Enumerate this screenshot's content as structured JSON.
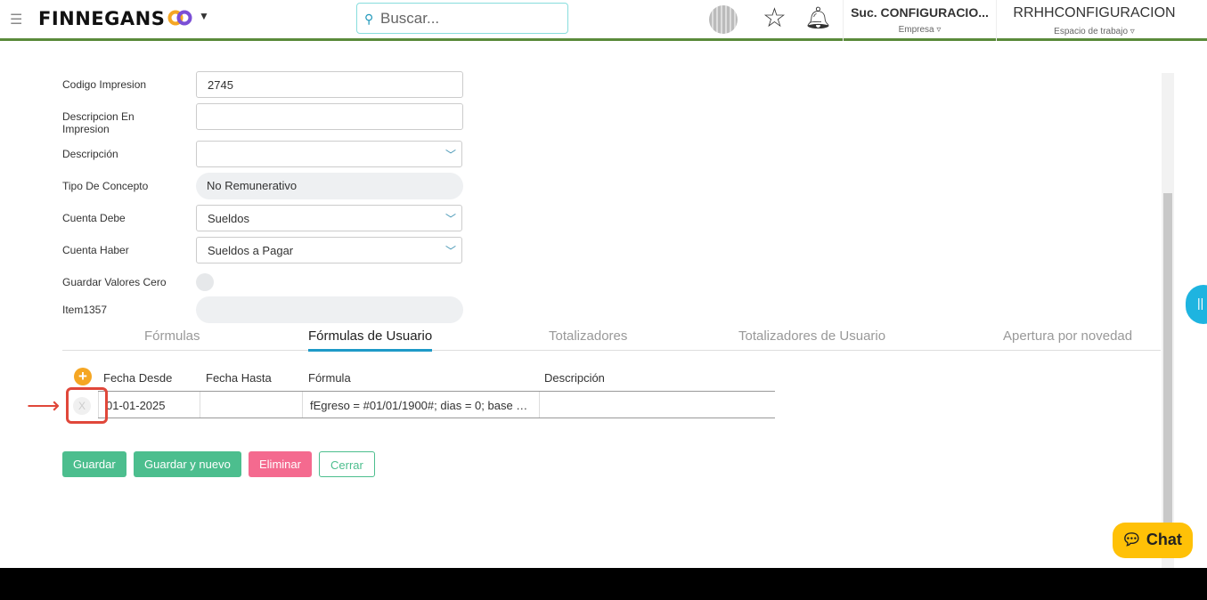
{
  "header": {
    "brand": "FINNEGANS",
    "search_placeholder": "Buscar...",
    "company": "Suc. CONFIGURACIO...",
    "company_label": "Empresa",
    "workspace": "RRHHCONFIGURACION",
    "workspace_label": "Espacio de trabajo"
  },
  "form": {
    "codigo_impresion": {
      "label": "Codigo Impresion",
      "value": "2745"
    },
    "descripcion_impresion": {
      "label": "Descripcion En Impresion",
      "value": ""
    },
    "descripcion": {
      "label": "Descripción",
      "value": ""
    },
    "tipo_concepto": {
      "label": "Tipo De Concepto",
      "value": "No Remunerativo"
    },
    "cuenta_debe": {
      "label": "Cuenta Debe",
      "value": "Sueldos"
    },
    "cuenta_haber": {
      "label": "Cuenta Haber",
      "value": "Sueldos a Pagar"
    },
    "guardar_cero": {
      "label": "Guardar Valores Cero"
    },
    "item1357": {
      "label": "Item1357",
      "value": ""
    }
  },
  "tabs": [
    "Fórmulas",
    "Fórmulas de Usuario",
    "Totalizadores",
    "Totalizadores de Usuario",
    "Apertura por novedad"
  ],
  "grid": {
    "columns": [
      "Fecha Desde",
      "Fecha Hasta",
      "Fórmula",
      "Descripción"
    ],
    "rows": [
      {
        "delete": "X",
        "fecha_desde": "01-01-2025",
        "fecha_hasta": "",
        "formula": "fEgreso = #01/01/1900#; dias = 0; base …",
        "descripcion": ""
      }
    ]
  },
  "buttons": {
    "guardar": "Guardar",
    "guardar_nuevo": "Guardar y nuevo",
    "eliminar": "Eliminar",
    "cerrar": "Cerrar"
  },
  "chat": "Chat",
  "colors": {
    "green": "#4cbe8e",
    "pink": "#f46a8f",
    "accent": "#1e9ac8",
    "topline": "#5a8a3a"
  }
}
